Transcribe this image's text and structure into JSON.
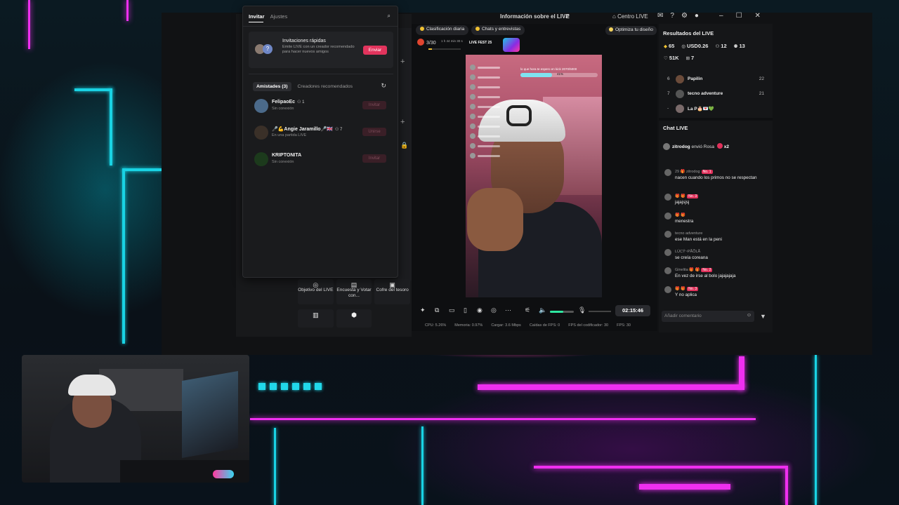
{
  "window": {
    "title": "Información sobre el LIVE",
    "centro_live": "Centro LIVE"
  },
  "invite_popup": {
    "tabs": [
      "Invitar",
      "Ajustes"
    ],
    "quick_invites": {
      "title": "Invitaciones rápidas",
      "description": "Emite LIVE con un creador recomendado para hacer nuevos amigos",
      "button": "Enviar"
    },
    "list_tabs": [
      "Amistades (3)",
      "Creadores recomendados"
    ],
    "friends": [
      {
        "name": "FelipaoEc",
        "count": "1",
        "status": "Sin conexión",
        "button": "Invitar"
      },
      {
        "name": "🎤💪Angie Jaramillo🎤🇬🇧",
        "count": "7",
        "status": "En una partida LIVE",
        "button": "Unirse"
      },
      {
        "name": "KRIPTONITA",
        "count": "",
        "status": "Sin conexión",
        "button": "Invitar"
      }
    ]
  },
  "tools": [
    {
      "icon": "target-icon",
      "label": "Objetivo del LIVE"
    },
    {
      "icon": "poll-icon",
      "label": "Encuesta y Votar con..."
    },
    {
      "icon": "treasure-icon",
      "label": "Cofre del tesoro"
    },
    {
      "icon": "box-icon",
      "label": ""
    },
    {
      "icon": "hex-icon",
      "label": ""
    }
  ],
  "preview": {
    "chips": [
      "Clasificación diaria",
      "Chats y entrevistas"
    ],
    "rank_value": "3/30",
    "rank_note": "1 h 44 min 30 s",
    "rank_progress": 0.1,
    "fest_label": "LIVE FEST 25",
    "goal_text": "lo que hora te espero en kick 2070/5000",
    "goal_percent": "41%",
    "goal_fill": 0.41
  },
  "controls": {
    "timer": "02:15:46",
    "volume": 0.55
  },
  "stats": [
    "CPU: 5.26%",
    "Memoria: 0.97%",
    "Cargar: 3.6 Mbps",
    "Caídas de FPS: 0",
    "FPS del codificador: 30",
    "FPS: 30"
  ],
  "results": {
    "optimize": "Optimiza tu diseño",
    "title": "Resultados del LIVE",
    "diamonds": "65",
    "usd": "USD0.26",
    "viewers": "12",
    "followers": "13",
    "likes": "51K",
    "gifts": "7",
    "leaderboard": [
      {
        "pos": "6",
        "name": "Papilin",
        "score": "22"
      },
      {
        "pos": "7",
        "name": "tecno adventure",
        "score": "21"
      },
      {
        "pos": "-",
        "name": "La P🎂💌💚",
        "score": ""
      }
    ]
  },
  "chat": {
    "title": "Chat LIVE",
    "gift": {
      "user": "zitrodog",
      "action": "envió Rosa",
      "mult": "x2"
    },
    "messages": [
      {
        "user": "29 🎁 zitrodog",
        "badge": "No. 1",
        "text": "nacen cuando los primos no se respectan"
      },
      {
        "user": "🎁 🎁",
        "badge": "No. 3",
        "text": "jajajsjsj"
      },
      {
        "user": "🎁 🎁",
        "badge": "",
        "text": "menestra"
      },
      {
        "user": "tecno adventure",
        "badge": "",
        "text": "ese Man está en la peni"
      },
      {
        "user": "LÚCŸ~PÃÕLÃ",
        "badge": "",
        "text": "se creía coreana"
      },
      {
        "user": "Ginelita 🎁 🎁",
        "badge": "No. 2",
        "text": "En vez de irse al bolo jajajajaja"
      },
      {
        "user": "🎁 🎁",
        "badge": "No. 3",
        "text": "Y no aplica"
      }
    ],
    "comment_placeholder": "Añadir comentario"
  },
  "colors": {
    "accent": "#e2345d",
    "neon_cyan": "#19d3e4",
    "neon_pink": "#ef2ff0",
    "volume": "#2ee6a0"
  }
}
